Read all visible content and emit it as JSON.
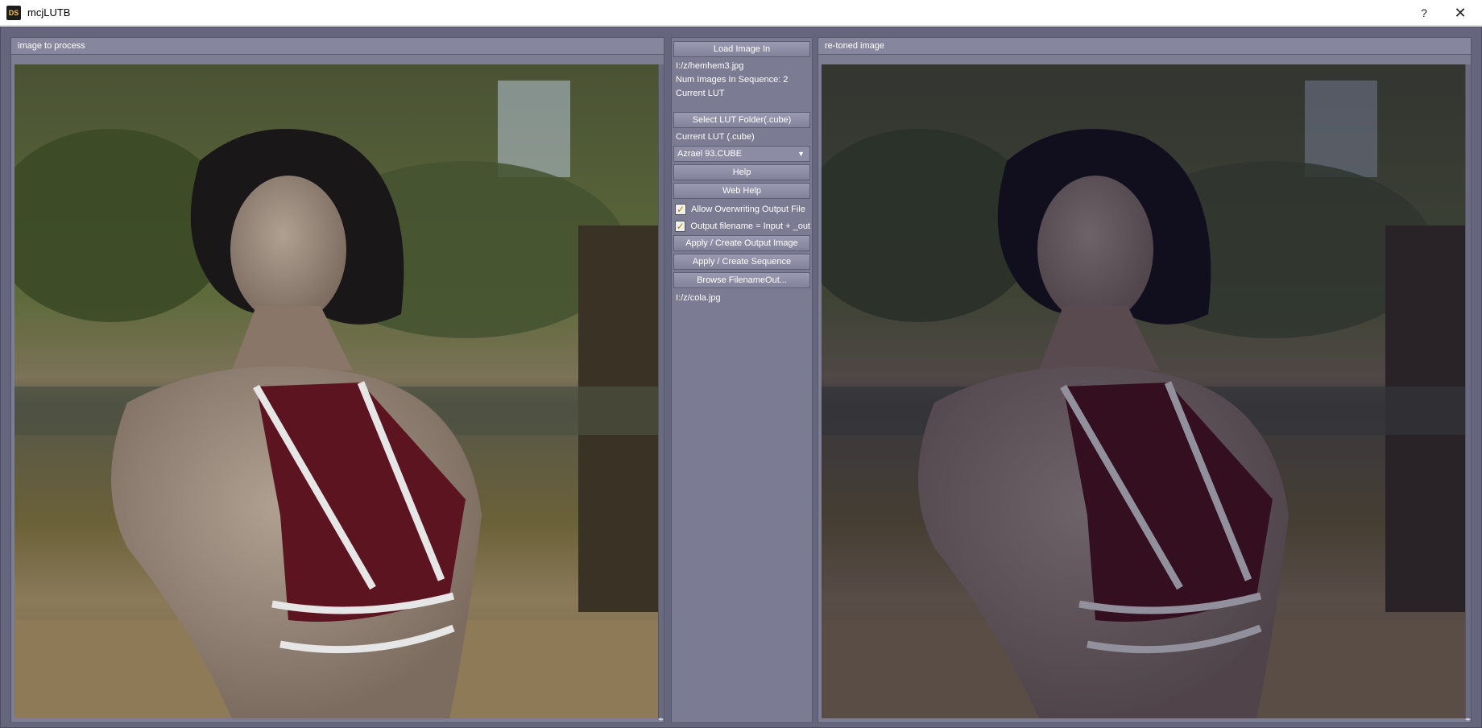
{
  "window": {
    "title": "mcjLUTB",
    "icon_text": "DS",
    "help_glyph": "?",
    "close_glyph": "✕"
  },
  "left_panel": {
    "title": "image to process"
  },
  "right_panel": {
    "title": "re-toned image"
  },
  "controls": {
    "load_image_label": "Load Image In",
    "input_path": "I:/z/hemhem3.jpg",
    "num_images": "Num Images In Sequence: 2",
    "current_lut_heading": "Current LUT",
    "select_lut_folder_label": "Select LUT Folder(.cube)",
    "current_lut_label": "Current LUT (.cube)",
    "lut_selected": "Azrael 93.CUBE",
    "help_label": "Help",
    "web_help_label": "Web Help",
    "allow_overwrite_label": "Allow Overwriting Output File",
    "output_filename_label": "Output filename = Input + _out",
    "apply_output_label": "Apply / Create Output Image",
    "apply_sequence_label": "Apply / Create Sequence",
    "browse_filename_label": "Browse FilenameOut...",
    "output_path": "I:/z/cola.jpg"
  },
  "colors": {
    "workspace": "#65657d",
    "panel": "#7d7d94",
    "check": "#c07a00"
  }
}
